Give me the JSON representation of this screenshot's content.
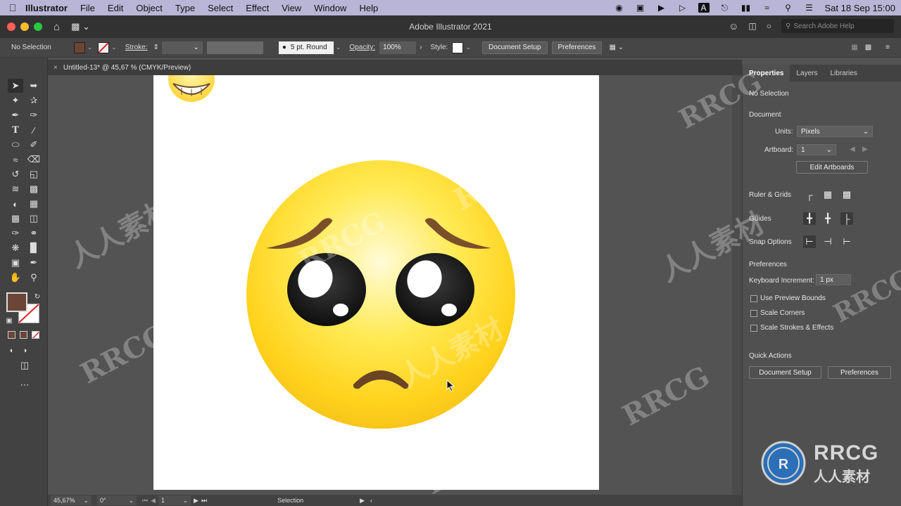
{
  "menubar": {
    "app_name": "Illustrator",
    "items": [
      "File",
      "Edit",
      "Object",
      "Type",
      "Select",
      "Effect",
      "View",
      "Window",
      "Help"
    ],
    "date_time": "Sat 18 Sep  15:00"
  },
  "window": {
    "title": "Adobe Illustrator 2021",
    "search_placeholder": "Search Adobe Help"
  },
  "control_bar": {
    "selection_label": "No Selection",
    "stroke_label": "Stroke:",
    "brush_label": "5 pt. Round",
    "opacity_label": "Opacity:",
    "opacity_value": "100%",
    "style_label": "Style:",
    "doc_setup_label": "Document Setup",
    "preferences_label": "Preferences"
  },
  "document_tab": {
    "title": "Untitled-13* @ 45,67 % (CMYK/Preview)"
  },
  "status_bar": {
    "zoom": "45,67%",
    "rotation": "0°",
    "artboard_number": "1",
    "tool_label": "Selection"
  },
  "panel": {
    "tabs": [
      "Properties",
      "Layers",
      "Libraries"
    ],
    "no_selection": "No Selection",
    "document_heading": "Document",
    "units_label": "Units:",
    "units_value": "Pixels",
    "artboard_label": "Artboard:",
    "artboard_value": "1",
    "edit_artboards": "Edit Artboards",
    "ruler_grids": "Ruler & Grids",
    "guides": "Guides",
    "snap_options": "Snap Options",
    "preferences_heading": "Preferences",
    "keyboard_increment_label": "Keyboard Increment:",
    "keyboard_increment_value": "1 px",
    "checkboxes": [
      "Use Preview Bounds",
      "Scale Corners",
      "Scale Strokes & Effects"
    ],
    "quick_actions": "Quick Actions",
    "qa_document_setup": "Document Setup",
    "qa_preferences": "Preferences"
  },
  "watermark": {
    "logo_text": "RRCG",
    "logo_subtext": "人人素材",
    "overlay_cn": "人人素材",
    "overlay_en": "RRCG"
  },
  "colors": {
    "fill": "#6b4536",
    "emoji_yellow": "#ffe02a",
    "brow_brown": "#7a4f2a",
    "accent_menubar": "#b9b5d6"
  }
}
